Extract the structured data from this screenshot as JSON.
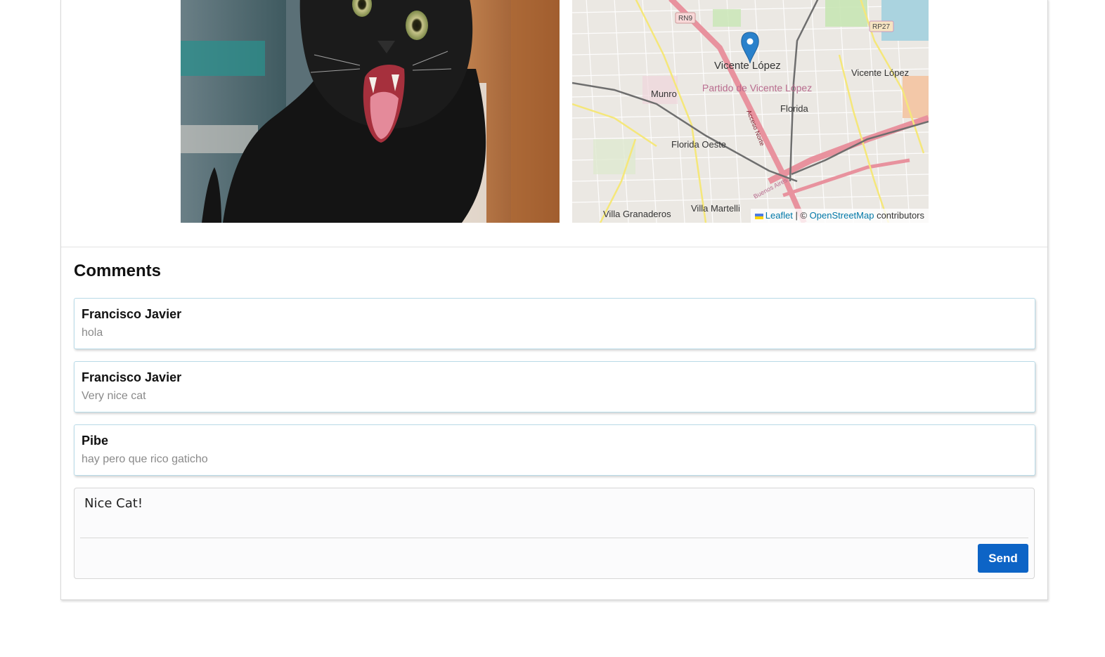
{
  "post": {
    "image": {
      "subject": "black cat",
      "alt": ""
    },
    "map": {
      "labels": [
        "RN9",
        "RP27",
        "Vicente López",
        "Partido de Vicente López",
        "Vicente López",
        "Munro",
        "Florida",
        "Florida Oeste",
        "Acceso Norte",
        "Villa Granaderos",
        "Villa Martelli",
        "Buenos Aires"
      ],
      "attribution": {
        "leaflet_link": "Leaflet",
        "separator": "| ©",
        "osm_link": "OpenStreetMap",
        "suffix": "contributors"
      }
    }
  },
  "comments": {
    "title": "Comments",
    "items": [
      {
        "author": "Francisco Javier",
        "text": "hola"
      },
      {
        "author": "Francisco Javier",
        "text": "Very nice cat"
      },
      {
        "author": "Pibe",
        "text": "hay pero que rico gaticho"
      }
    ]
  },
  "composer": {
    "value": "Nice Cat!",
    "send_label": "Send"
  },
  "colors": {
    "primary": "#0d64c6",
    "map_marker": "#2a81cb",
    "comment_border": "#b9dbe8"
  }
}
